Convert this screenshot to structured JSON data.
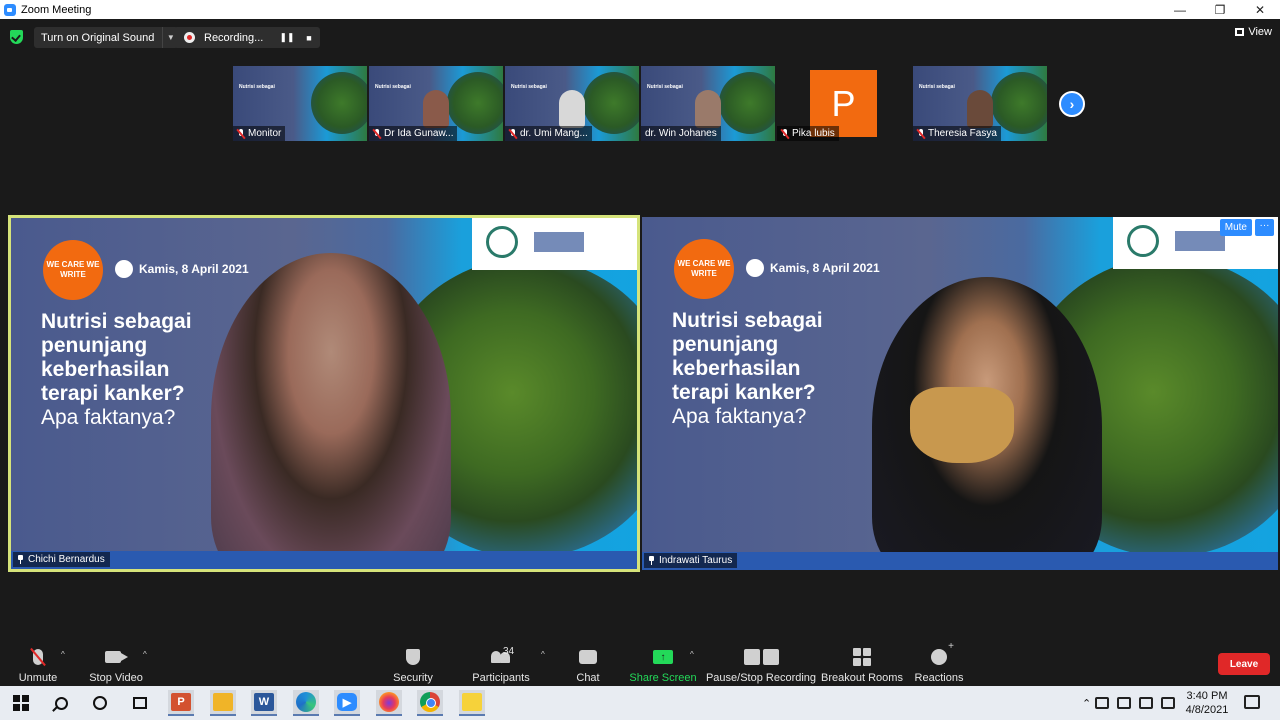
{
  "window": {
    "title": "Zoom Meeting",
    "minimize": "—",
    "maximize": "❐",
    "close": "✕"
  },
  "topbar": {
    "original_sound": "Turn on Original Sound",
    "recording_label": "Recording...",
    "pause_glyph": "❚❚",
    "stop_glyph": "■",
    "view_label": "View"
  },
  "thumbnails": [
    {
      "name": "Monitor",
      "muted": true
    },
    {
      "name": "Dr Ida Gunaw...",
      "muted": true
    },
    {
      "name": "dr. Umi Mang...",
      "muted": true
    },
    {
      "name": "dr. Win Johanes",
      "muted": false
    },
    {
      "name": "Pika lubis",
      "muted": true,
      "avatar_letter": "P",
      "avatar_color": "#f26a10"
    },
    {
      "name": "Theresia Fasya",
      "muted": true
    }
  ],
  "slide": {
    "badge": "WE CARE WE WRITE",
    "date": "Kamis, 8 April 2021",
    "headline": [
      "Nutrisi sebagai",
      "penunjang",
      "keberhasilan",
      "terapi kanker?"
    ],
    "subheadline": "Apa faktanya?"
  },
  "main_videos": {
    "left": {
      "name": "Chichi Bernardus",
      "highlight_color": "#d5e37a"
    },
    "right": {
      "name": "Indrawati Taurus",
      "mute_label": "Mute",
      "more_label": "···"
    }
  },
  "toolbar": {
    "unmute": "Unmute",
    "stop_video": "Stop Video",
    "security": "Security",
    "participants": "Participants",
    "participant_count": "34",
    "chat": "Chat",
    "share_screen": "Share Screen",
    "pause_stop_recording": "Pause/Stop Recording",
    "breakout_rooms": "Breakout Rooms",
    "reactions": "Reactions",
    "leave": "Leave",
    "caret": "^"
  },
  "taskbar": {
    "apps": [
      "powerpoint-icon",
      "file-explorer-icon",
      "word-icon",
      "edge-icon",
      "zoom-icon",
      "firefox-icon",
      "chrome-icon",
      "sticky-notes-icon"
    ],
    "time": "3:40 PM",
    "date": "4/8/2021"
  },
  "colors": {
    "accent": "#2d8cff",
    "leave": "#e02828",
    "share": "#23d959",
    "speaker_border": "#d5e37a"
  }
}
